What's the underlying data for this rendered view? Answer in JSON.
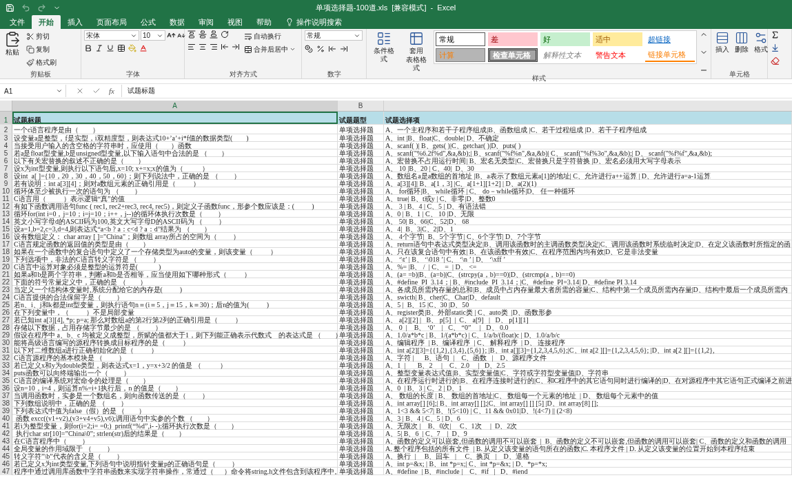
{
  "title_bar": {
    "title": "单项选择题-100道.xls  [兼容模式]  -  Excel"
  },
  "tabs": [
    {
      "label": "文件",
      "selected": false
    },
    {
      "label": "开始",
      "selected": true
    },
    {
      "label": "插入",
      "selected": false
    },
    {
      "label": "页面布局",
      "selected": false
    },
    {
      "label": "公式",
      "selected": false
    },
    {
      "label": "数据",
      "selected": false
    },
    {
      "label": "审阅",
      "selected": false
    },
    {
      "label": "视图",
      "selected": false
    },
    {
      "label": "帮助",
      "selected": false
    }
  ],
  "tell_me": "操作说明搜索",
  "ribbon": {
    "clipboard": {
      "label": "剪贴板",
      "paste": "粘贴",
      "cut": "剪切",
      "copy": "复制",
      "format_painter": "格式刷"
    },
    "font": {
      "label": "字体",
      "font_name": "宋体",
      "font_size": "10"
    },
    "alignment": {
      "label": "对齐方式",
      "wrap_text": "自动换行",
      "merge_center": "合并后居中"
    },
    "number": {
      "label": "数字",
      "format": "常规"
    },
    "styles": {
      "label": "样式",
      "conditional_formatting": "条件格式",
      "format_as_table": [
        "套用",
        "表格格式"
      ],
      "cell_styles": [
        {
          "label": "常规",
          "kind": "normal"
        },
        {
          "label": "差",
          "kind": "bad"
        },
        {
          "label": "好",
          "kind": "good"
        },
        {
          "label": "适中",
          "kind": "neutral"
        },
        {
          "label": "超链接",
          "kind": "hyperlink"
        },
        {
          "label": "计算",
          "kind": "calculation"
        },
        {
          "label": "检查单元格",
          "kind": "check"
        },
        {
          "label": "解释性文本",
          "kind": "explanatory"
        },
        {
          "label": "警告文本",
          "kind": "warning"
        },
        {
          "label": "链接单元格",
          "kind": "linked"
        }
      ]
    },
    "cells": {
      "label": "单元格",
      "buttons": [
        "插入",
        "删除",
        "格式"
      ]
    }
  },
  "formula_bar": {
    "name_box": "A1",
    "function_label": "fx",
    "formula": "试题标题"
  },
  "sheet": {
    "columns": [
      "A",
      "B"
    ],
    "rows": [
      {
        "number": "1",
        "kind": "header",
        "selected": true,
        "a": "试题标题",
        "b": "试题题型",
        "c": "试题选择项"
      },
      {
        "number": "2",
        "kind": "data",
        "selected": false,
        "a": "一个c语言程序是由（        ）",
        "b": "单项选择题",
        "c": "A、一个主程序和若干子程序组成|B、函数组成 |C、若干过程组成 |D、若干子程序组成"
      },
      {
        "number": "3",
        "kind": "data",
        "selected": false,
        "a": "设变量a是整型，f是实型，i双精度型，则表达式10+’a’+i*f值的数据类型(        )",
        "b": "单项选择题",
        "c": "A、int |B、float|C、double| D、不确定"
      },
      {
        "number": "4",
        "kind": "data",
        "selected": false,
        "a": "当接受用户输入的含空格的字符串时，应使用（       ）函数",
        "b": "单项选择题",
        "c": "A、scanf( )| B、gets( )|C、getchar( )|D、puts( )"
      },
      {
        "number": "5",
        "kind": "data",
        "selected": false,
        "a": "若a是float型变量,b是unsigned型变量,以下输入语句中合法的是 （        ）",
        "b": "单项选择题",
        "c": "A、scanf(\"%6.2f%d\",&a,&b);| B、scanf(\"%f%n\",&a,&b)| C、 scanf(\"%f%3o\",&a,&b);| D、 scanf(\"%f%f\",&a,&b);"
      },
      {
        "number": "6",
        "kind": "data",
        "selected": false,
        "a": "以下有关宏替换的叙述不正确的是（        ）",
        "b": "单项选择题",
        "c": "A、宏替换不占用运行时间| B、宏名无类型|C、宏替换只是字符替换 |D、宏名必须用大写字母表示"
      },
      {
        "number": "7",
        "kind": "data",
        "selected": false,
        "a": "设x为int型变量,则执行以下语句后,x=10; x+=x;x的值为（           ）",
        "b": "单项选择题",
        "c": "A、 10 |B、20 | C、40|  D、30"
      },
      {
        "number": "8",
        "kind": "data",
        "selected": false,
        "a": "设int  a[ ]={10，20，30，40，50，60}；则下列说法中，正确的是 （         ）",
        "b": "单项选择题",
        "c": "A、数组名a是a数组的首地址 |B、a表示了数组元素a[1]的地址| C、允许进行a++运算 | D、允许进行a=a-1运算"
      },
      {
        "number": "9",
        "kind": "data",
        "selected": false,
        "a": "若有说明：int a[3][4]；则对a数组元素的正确引用是（          ）",
        "b": "单项选择题",
        "c": "A、a[3][4]| B、a[1，3] |C、a[1+1][1+2] | D、a(2)(1)"
      },
      {
        "number": "10",
        "kind": "data",
        "selected": false,
        "a": "循环体至少被执行一次的语句为 （         ）",
        "b": "单项选择题",
        "c": "A、 for循环|B、 while循环 | C、 do－while循环|D、 任一种循环"
      },
      {
        "number": "11",
        "kind": "data",
        "selected": false,
        "a": "C语言用（          ）表示逻辑“真”的值",
        "b": "单项选择题",
        "c": "A、true| B、t或y | C、非零|D、整数0"
      },
      {
        "number": "12",
        "kind": "data",
        "selected": false,
        "a": "有如下函数调用语句func ( rec1, rec2+rec3, rec4, rec5)，则定义子函数func，形参个数应该是：(          )",
        "b": "单项选择题",
        "c": "A、 3 | B、4 | C、5 | D、有语法错"
      },
      {
        "number": "13",
        "kind": "data",
        "selected": false,
        "a": "循环for(int i=0，j=10；i=j=10；i++，j--)的循环体执行次数是（         ）",
        "b": "单项选择题",
        "c": "A、0 | B、1 | C、 10 |D、无限"
      },
      {
        "number": "14",
        "kind": "data",
        "selected": false,
        "a": "英文小写字母d的ASCII码为100,英文大写字母D的ASCII码为 （         ）",
        "b": "单项选择题",
        "c": "A、 50| B、66|C、52|D、 68"
      },
      {
        "number": "15",
        "kind": "data",
        "selected": false,
        "a": "设a=1,b=2,c=3,d=4,则表达式“a<b ? a：c<d ? a：d”结果为 （        ）",
        "b": "单项选择题",
        "c": "A、4|  B、3|C、2|D、1"
      },
      {
        "number": "16",
        "kind": "data",
        "selected": false,
        "a": "设有数组定义： char array [ ]=\"China\"；则数组 array所占的空间为（         ）",
        "b": "单项选择题",
        "c": "A、 4个字节|  B、5个字节| C、6个字节| D、7个字节"
      },
      {
        "number": "17",
        "kind": "data",
        "selected": false,
        "a": "C语言规定函数的返回值的类型是由（        ）",
        "b": "单项选择题",
        "c": "A、return语句中表达式类型决定|B、调用该函数时的主调函数类型决定|C、调用该函数时系统临时决定|D、在定义该函数时所指定的函"
      },
      {
        "number": "18",
        "kind": "data",
        "selected": false,
        "a": "如果在一个函数中的复合语句中定义了一个存储类型为auto的变量，则该变量（          ）",
        "b": "单项选择题",
        "c": "A、只在该复合语句中有效| B、在该函数中有效|C、在程序范围内均有效|D、它是非法变量"
      },
      {
        "number": "19",
        "kind": "data",
        "selected": false,
        "a": "下列选项中，非法的C语言转义字符是 （         ）",
        "b": "单项选择题",
        "c": "A、 ‘\\t’ | B、 ‘\\018 ’| C、 ‘\\n ’ | D、 ‘\\xff ’"
      },
      {
        "number": "20",
        "kind": "data",
        "selected": false,
        "a": "C语言中运算对象必须是整型的运算符是(            )",
        "b": "单项选择题",
        "c": "A、%= |B、 /  | C、 =  | D、 <="
      },
      {
        "number": "21",
        "kind": "data",
        "selected": false,
        "a": "如果a和b是两个字符串，判断a和b是否相等，应当使用如下哪种形式（          ）",
        "b": "单项选择题",
        "c": "A、(a= =b)|B、(a=b)|C、(strcpy(a，b)==0)|D、(strcmp(a，b)==0)"
      },
      {
        "number": "22",
        "kind": "data",
        "selected": false,
        "a": "下面的符号常量定义中，正确的是 （        ）",
        "b": "单项选择题",
        "c": "A、#define  PI  3.14；| B、#include  PI  3.14；|C、#define  PI=3.14| D、#define PI 3.14"
      },
      {
        "number": "23",
        "kind": "data",
        "selected": false,
        "a": "当定义一个结构体变量时,系统分配给它的内存是(          )",
        "b": "单项选择题",
        "c": "A、各成员所需内存量的总和|B、成员中占内存量最大者所需的容量|C、结构中第一个成员所需内存量|D、结构中最后一个成员所需内"
      },
      {
        "number": "24",
        "kind": "data",
        "selected": false,
        "a": "C语言提供的合法保留字是（         ）",
        "b": "单项选择题",
        "c": "A、swicth| B、cher|C、Char|D、default"
      },
      {
        "number": "25",
        "kind": "data",
        "selected": false,
        "a": "若n、i、j和k都是int型变量，则执行语句n＝(i＝5，j＝15，k＝30)；后n的值为(          )",
        "b": "单项选择题",
        "c": "A、5 |  B、15 |C、30 |D、50"
      },
      {
        "number": "26",
        "kind": "data",
        "selected": false,
        "a": "在下列变量中，（          ）不是局部变量",
        "b": "单项选择题",
        "c": "A、register类|B、外部static类 | C、auto类  |D、函数形参"
      },
      {
        "number": "27",
        "kind": "data",
        "selected": false,
        "a": "若已知int a[3][4], *p; p=a; 那么对数组a的第2行第2列的正确引用是（          ）",
        "b": "单项选择题",
        "c": "A、 a[2][2] |   B、 p[5]  |  C、 a[9]   |   D、 p[1][1]"
      },
      {
        "number": "28",
        "kind": "data",
        "selected": false,
        "a": "存储以下数据，占用存储字节最少的是 （         ）",
        "b": "单项选择题",
        "c": "A、 0  |    B、 ‘0’    |   C、 “0”     |   D、 0.0"
      },
      {
        "number": "29",
        "kind": "data",
        "selected": false,
        "a": "假设在程序中 a、b、c 均被定义成整型，所赋的值都大于1，则下列能正确表示代数式    的表达式是 （        ）",
        "b": "单项选择题",
        "c": "A、1.0/a*b*c | B、1/(a*b*c) | C、1/a/b/(float)c | D、1.0/a/b/c"
      },
      {
        "number": "30",
        "kind": "data",
        "selected": false,
        "a": "能将高级语言编写的源程序转换成目标程序的是（          ）",
        "b": "单项选择题",
        "c": "A、编辑程序  | B、编译程序  | C、 解释程序  | D、 连接程序"
      },
      {
        "number": "31",
        "kind": "data",
        "selected": false,
        "a": "以下对二维数组a进行正确初始化的是（          ）",
        "b": "单项选择题",
        "c": "A、int a[2][3]={{1,2},{3,4},{5,6}}; |B、int a[][3]={1,2,3,4,5,6};|C、int a[2 ][]={1,2,3,4,5,6}; |D、int a[2 ][]={{1,2},"
      },
      {
        "number": "32",
        "kind": "data",
        "selected": false,
        "a": "C语言源程序的基本模块是 （         ）",
        "b": "单项选择题",
        "c": "A、字符 |      B、语句  |    C、函数   |    D、源程序文件"
      },
      {
        "number": "33",
        "kind": "data",
        "selected": false,
        "a": "若已定义x和y为double类型，则表达式x=1，y=x+3/2 的值是 （           ）",
        "b": "单项选择题",
        "c": "A、1  |       B、2     |    C、2.0     |   D、2.5"
      },
      {
        "number": "34",
        "kind": "data",
        "selected": false,
        "a": "puts函数可以向终端输出一个（         ）",
        "b": "单项选择题",
        "c": "A、整型变量表达式值|B、实型变量值|C、字符或字符型变量值|D、字符串"
      },
      {
        "number": "35",
        "kind": "data",
        "selected": false,
        "a": "C语言的编译系统对宏命令的处理是（        ）",
        "b": "单项选择题",
        "c": "A、在程序运行时进行的|B、在程序连接时进行的|C、和C程序中的其它语句同时进行编译的|D、在对源程序中其它语句正式编译之前进"
      },
      {
        "number": "36",
        "kind": "data",
        "selected": false,
        "a": "设n=10，i=4，则运算n%=i+1执行后，n 的值是（        ）",
        "b": "单项选择题",
        "c": "A、0  | B、3 | C、2 | D、1"
      },
      {
        "number": "37",
        "kind": "data",
        "selected": false,
        "a": "当调用函数时，实参是一个数组名，则向函数传送的是（         ）",
        "b": "单项选择题",
        "c": "A、 数组的长度 | B、 数组的首地址|C、 数组每一个元素的地址  | D、 数组每个元素中的值"
      },
      {
        "number": "38",
        "kind": "data",
        "selected": false,
        "a": "下列数组说明中，正确的是 （         ）",
        "b": "单项选择题",
        "c": "A、int array[] [6];| B、int array[] [];|C、int array[] [] [5] |D、int array[8] [];"
      },
      {
        "number": "39",
        "kind": "data",
        "selected": false,
        "a": "下列表达式中值为false（假）的是 （        ）",
        "b": "单项选择题",
        "c": "A、1<3 && 5<7| B、!(5<10) | C、11 && 0x01|D、!(4<7) || (2<8)"
      },
      {
        "number": "40",
        "kind": "data",
        "selected": false,
        "a": " 函数 excc((v1+v2),(v3+v4+v5),v6);调用语句中实参的个数 （        ）",
        "b": "单项选择题",
        "c": "A、3 | B、4 | C、5 | D、6"
      },
      {
        "number": "41",
        "kind": "data",
        "selected": false,
        "a": "若i为整型变量，则for(i=2;i= =0;)  printf(“%d”,i- -);循环执行次数是（        ）",
        "b": "单项选择题",
        "c": "A、无限次 |    B、0次|     C、1次     |  D、2次"
      },
      {
        "number": "42",
        "kind": "data",
        "selected": false,
        "a": " 执行char str[10]=”China\\0”; strlen(str)后的结果是（        ）",
        "b": "单项选择题",
        "c": "A、5| B、6  | C、7    |  D、9"
      },
      {
        "number": "43",
        "kind": "data",
        "selected": false,
        "a": "在C语言程序中（         ）",
        "b": "单项选择题",
        "c": "A、函数的定义可以嵌套,但函数的调用不可以嵌套  |  B、函数的定义不可以嵌套,但函数的调用可以嵌套| C、函数的定义和函数的调用"
      },
      {
        "number": "44",
        "kind": "data",
        "selected": false,
        "a": "全局变量的作用域限于 （         ）",
        "b": "单项选择题",
        "c": "A. 整个程序包括的所有文件  | B. 从定义该变量的语句所在的函数|C. 本程序文件 | D. 从定义该变量的位置开始到本程序结束"
      },
      {
        "number": "45",
        "kind": "data",
        "selected": false,
        "a": "转义字符”\\b”代表的含义是（         ）",
        "b": "单项选择题",
        "c": "A、换行  |     B、回车   |     C、换页   |    D、退格"
      },
      {
        "number": "46",
        "kind": "data",
        "selected": false,
        "a": "若已定义x为int类型变量,下列语句中说明指针变量p的正确语句是（         ）",
        "b": "单项选择题",
        "c": "A、int p=&x; | B、int *p=x;| C、int *p=&x; | D、*p=*x;"
      },
      {
        "number": "47",
        "kind": "data",
        "selected": false,
        "a": "程序中通过调用库函数中字符串函数来实现字符串操作，常通过（      ）命令将string.h文件包含到该程序中。",
        "b": "单项选择题",
        "c": "A、#define  | B、#include |    C、#if   |   D、#iend"
      }
    ]
  }
}
